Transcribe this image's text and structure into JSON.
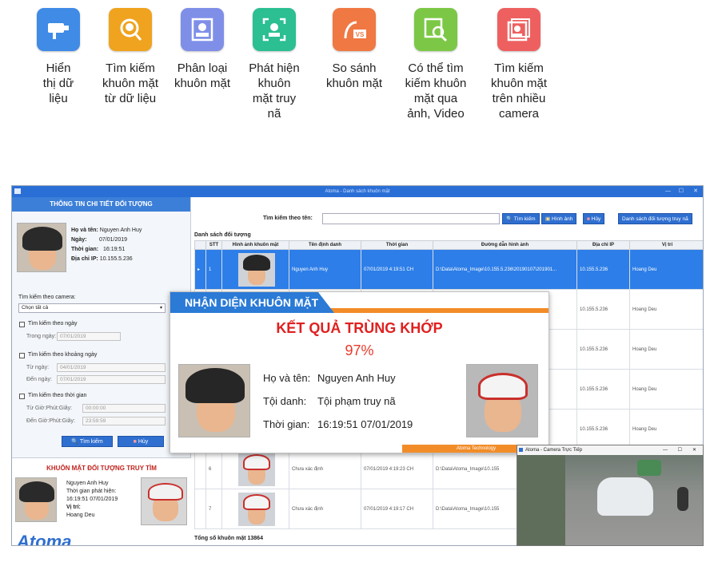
{
  "features": [
    {
      "label": "Hiển\nthị dữ\nliệu",
      "icon": "camera-icon",
      "color": "#3f8be6"
    },
    {
      "label": "Tìm kiếm\nkhuôn mặt\ntừ dữ liệu",
      "icon": "face-search-icon",
      "color": "#f0a31e"
    },
    {
      "label": "Phân loại\nkhuôn mặt",
      "icon": "portrait-icon",
      "color": "#7f8fe8"
    },
    {
      "label": "Phát hiện\nkhuôn\nmặt truy\nnã",
      "icon": "face-scan-icon",
      "color": "#2bbf92"
    },
    {
      "label": "So sánh\nkhuôn mặt",
      "icon": "face-versus-icon",
      "color": "#f07842"
    },
    {
      "label": "Có thể tìm\nkiếm khuôn\nmặt qua\nảnh, Video",
      "icon": "image-search-icon",
      "color": "#7cc846"
    },
    {
      "label": "Tìm kiếm\nkhuôn mặt\ntrên nhiều\ncamera",
      "icon": "multi-camera-icon",
      "color": "#ee6060"
    }
  ],
  "window": {
    "title": "Atoma - Danh sách khuôn mặt"
  },
  "detail": {
    "header": "THÔNG TIN CHI TIẾT ĐỐI TƯỢNG",
    "name_label": "Họ và tên:",
    "name": "Nguyen Anh Huy",
    "date_label": "Ngày:",
    "date": "07/01/2019",
    "time_label": "Thời gian:",
    "time": "16:19:51",
    "ip_label": "Địa chỉ IP:",
    "ip": "10.155.5.236"
  },
  "filters": {
    "camera_label": "Tìm kiếm theo camera:",
    "camera_value": "Chọn tất cả",
    "by_day": "Tìm kiếm theo ngày",
    "in_day_label": "Trong ngày:",
    "in_day": "07/01/2019",
    "by_range": "Tìm kiếm theo khoảng ngày",
    "from_label": "Từ ngày:",
    "from": "04/01/2019",
    "to_label": "Đến ngày:",
    "to": "07/01/2019",
    "by_time": "Tìm kiếm theo thời gian",
    "from_time_label": "Từ Giờ:Phút:Giây:",
    "from_time": "00:00:00",
    "to_time_label": "Đến Giờ:Phút:Giây:",
    "to_time": "23:59:59",
    "search_btn": "Tìm kiếm",
    "cancel_btn": "Hủy"
  },
  "wanted": {
    "header": "KHUÔN MẶT ĐỐI TƯỢNG TRUY TÌM",
    "name": "Nguyen Anh Huy",
    "detected_label": "Thời gian phát hiện:",
    "detected": "16:19:51 07/01/2019",
    "location_label": "Vị trí:",
    "location": "Hoang Deu",
    "brand": "Atoma"
  },
  "search": {
    "label": "Tìm kiếm theo tên:",
    "placeholder": "",
    "btn_search": "Tìm kiếm",
    "btn_image": "Hình ảnh",
    "btn_cancel": "Hủy",
    "btn_wanted": "Danh sách đối tượng truy nã"
  },
  "list": {
    "title": "Danh sách đối tượng",
    "columns": [
      "STT",
      "Hình ảnh khuôn mặt",
      "Tên định danh",
      "Thời gian",
      "Đường dẫn hình ảnh",
      "Địa chỉ IP",
      "Vị trí"
    ],
    "rows": [
      {
        "stt": "1",
        "name": "Nguyen Anh Huy",
        "time": "07/01/2019 4:19:51 CH",
        "path": "D:\\Data\\Atoma_Image\\10.155.5.236\\20190107\\201901...",
        "ip": "10.155.5.236",
        "loc": "Hoang Deu"
      },
      {
        "stt": "",
        "name": "",
        "time": "",
        "path": "07\\201901...",
        "ip": "10.155.5.236",
        "loc": "Hoang Deu"
      },
      {
        "stt": "",
        "name": "",
        "time": "",
        "path": "07\\201901...",
        "ip": "10.155.5.236",
        "loc": "Hoang Deu"
      },
      {
        "stt": "",
        "name": "",
        "time": "",
        "path": "07\\201901...",
        "ip": "10.155.5.236",
        "loc": "Hoang Deu"
      },
      {
        "stt": "",
        "name": "",
        "time": "",
        "path": "07\\201901...",
        "ip": "10.155.5.236",
        "loc": "Hoang Deu"
      },
      {
        "stt": "6",
        "name": "Chưa xác định",
        "time": "07/01/2019 4:19:23 CH",
        "path": "D:\\Data\\Atoma_Image\\10.155",
        "ip": "",
        "loc": ""
      },
      {
        "stt": "7",
        "name": "Chưa xác định",
        "time": "07/01/2019 4:19:17 CH",
        "path": "D:\\Data\\Atoma_Image\\10.155",
        "ip": "",
        "loc": ""
      }
    ],
    "total": "Tổng số khuôn mặt 13864"
  },
  "match": {
    "tab": "NHẬN DIỆN KHUÔN MẶT",
    "result": "KẾT QUẢ TRÙNG KHỚP",
    "percent": "97%",
    "name_label": "Họ và tên:",
    "name": "Nguyen Anh Huy",
    "crime_label": "Tội danh:",
    "crime": "Tội phạm truy nã",
    "time_label": "Thời gian:",
    "time": "16:19:51 07/01/2019",
    "footer": "Atoma Technology"
  },
  "camera": {
    "title": "Atoma - Camera Trực Tiếp"
  }
}
